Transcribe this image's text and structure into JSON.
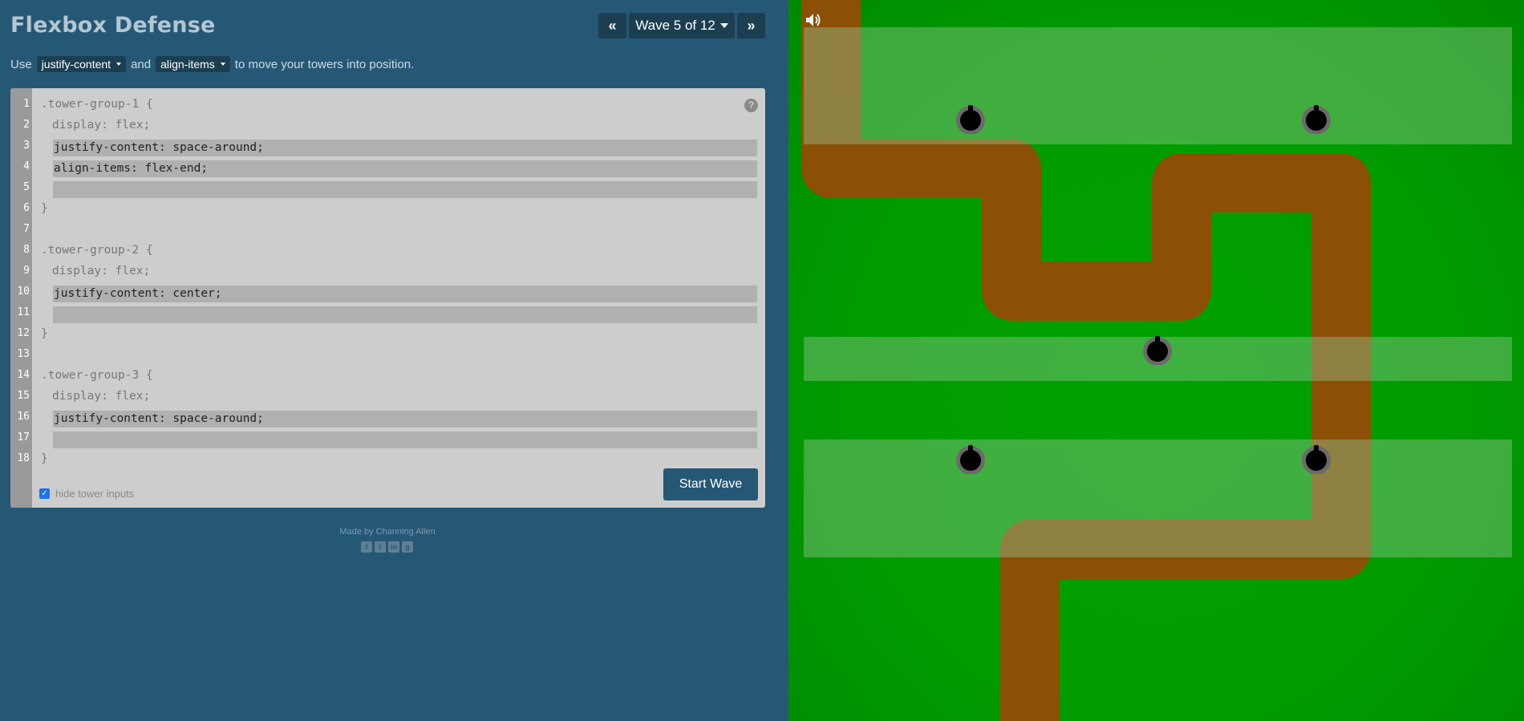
{
  "title": "Flexbox Defense",
  "wave": {
    "label": "Wave 5 of 12",
    "prev_glyph": "«",
    "next_glyph": "»"
  },
  "instructions": {
    "use": "Use",
    "prop1": "justify-content",
    "and": "and",
    "prop2": "align-items",
    "suffix": "to move your towers into position."
  },
  "editor": {
    "line_numbers": [
      "1",
      "2",
      "3",
      "4",
      "5",
      "6",
      "7",
      "8",
      "9",
      "10",
      "11",
      "12",
      "13",
      "14",
      "15",
      "16",
      "17",
      "18"
    ],
    "lines": {
      "l1": ".tower-group-1 {",
      "l2": "display: flex;",
      "l3": "justify-content: space-around;",
      "l4": "align-items: flex-end;",
      "l5": "",
      "l6": "}",
      "l8": ".tower-group-2 {",
      "l9": "display: flex;",
      "l10": "justify-content: center;",
      "l11": "",
      "l12": "}",
      "l14": ".tower-group-3 {",
      "l15": "display: flex;",
      "l16": "justify-content: space-around;",
      "l17": "",
      "l18": "}"
    },
    "help_glyph": "?",
    "hide_inputs_label": "hide tower inputs",
    "hide_inputs_checked": true,
    "start_button": "Start Wave"
  },
  "footer": {
    "credit": "Made by Channing Allen",
    "social_icons": [
      "facebook-icon",
      "twitter-icon",
      "linkedin-icon",
      "github-icon"
    ]
  },
  "game": {
    "colors": {
      "grass": "#00a000",
      "path": "#8b4f05",
      "zone": "#7fcf7f",
      "tower": "#000000",
      "tower_ring": "#6a6a6a"
    },
    "tower_groups": [
      {
        "name": "tower-group-1",
        "towers": 2
      },
      {
        "name": "tower-group-2",
        "towers": 1
      },
      {
        "name": "tower-group-3",
        "towers": 2
      }
    ]
  }
}
